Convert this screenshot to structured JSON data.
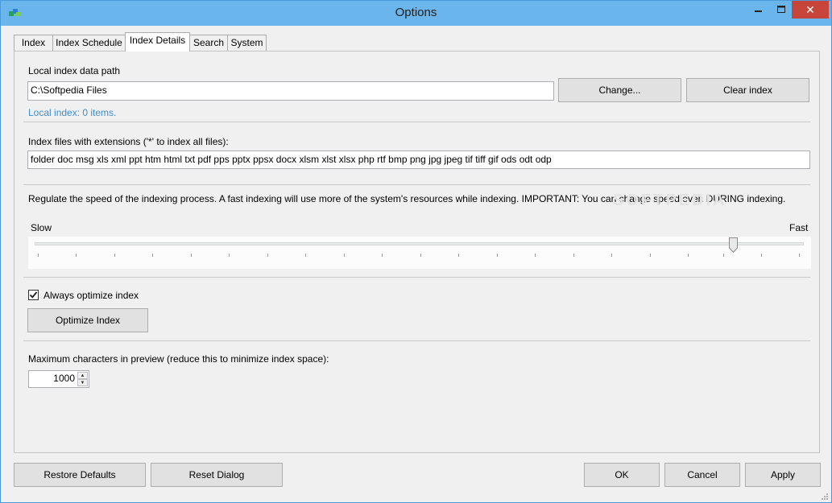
{
  "window": {
    "title": "Options",
    "close_glyph": "✕",
    "minimize_glyph": "‒",
    "maximize_glyph": "☐"
  },
  "tabs": [
    {
      "label": "Index"
    },
    {
      "label": "Index Schedule"
    },
    {
      "label": "Index Details"
    },
    {
      "label": "Search"
    },
    {
      "label": "System"
    }
  ],
  "active_tab": "Index Details",
  "index_details": {
    "path_label": "Local index data path",
    "path_value": "C:\\Softpedia Files",
    "change_button": "Change...",
    "clear_button": "Clear index",
    "status_link": "Local index: 0 items.",
    "extensions_label": "Index files with extensions ('*' to index all files):",
    "extensions_value": "folder doc msg xls xml ppt htm html txt pdf pps pptx ppsx docx xlsm xlst xlsx php rtf bmp png jpg jpeg tif tiff gif ods odt odp",
    "speed_description": "Regulate the speed of the indexing process. A fast indexing will use more of the system's resources while indexing. IMPORTANT: You can change speed even DURING indexing.",
    "slow_label": "Slow",
    "fast_label": "Fast",
    "speed_level_fraction": 0.9,
    "always_optimize_label": "Always optimize index",
    "always_optimize_checked": true,
    "optimize_button": "Optimize Index",
    "max_chars_label": "Maximum characters in preview (reduce this to minimize index space):",
    "max_chars_value": "1000"
  },
  "footer": {
    "restore_defaults": "Restore Defaults",
    "reset_dialog": "Reset Dialog",
    "ok": "OK",
    "cancel": "Cancel",
    "apply": "Apply"
  },
  "watermark": "SOFTPEDIA",
  "colors": {
    "titlebar": "#6ab6ec",
    "close_button": "#c7453a",
    "link": "#3b8fd6"
  }
}
